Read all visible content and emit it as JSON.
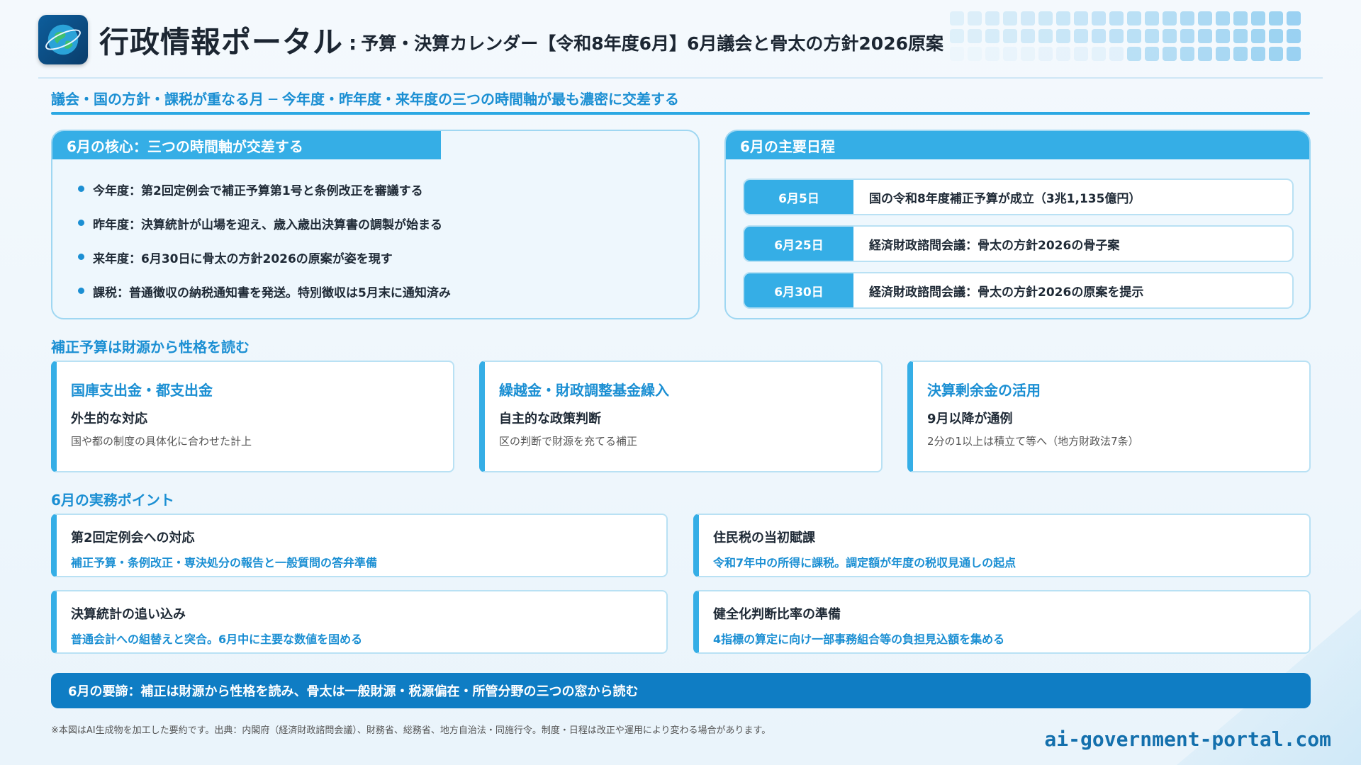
{
  "header": {
    "logo_icon": "globe-icon",
    "title": "行政情報ポータル",
    "separator": ":",
    "subtitle": "予算・決算カレンダー【令和8年度6月】6月議会と骨太の方針2026原案"
  },
  "tagline": "議会・国の方針・課税が重なる月 ─ 今年度・昨年度・来年度の三つの時間軸が最も濃密に交差する",
  "core": {
    "heading": "6月の核心：三つの時間軸が交差する",
    "items": [
      "今年度：第2回定例会で補正予算第1号と条例改正を審議する",
      "昨年度：決算統計が山場を迎え、歳入歳出決算書の調製が始まる",
      "来年度：6月30日に骨太の方針2026の原案が姿を現す",
      "課税：普通徴収の納税通知書を発送。特別徴収は5月末に通知済み"
    ]
  },
  "schedule": {
    "heading": "6月の主要日程",
    "rows": [
      {
        "date": "6月5日",
        "text": "国の令和8年度補正予算が成立（3兆1,135億円）"
      },
      {
        "date": "6月25日",
        "text": "経済財政諮問会議：骨太の方針2026の骨子案"
      },
      {
        "date": "6月30日",
        "text": "経済財政諮問会議：骨太の方針2026の原案を提示"
      }
    ]
  },
  "supplementary": {
    "heading": "補正予算は財源から性格を読む",
    "cards": [
      {
        "title": "国庫支出金・都支出金",
        "sub": "外生的な対応",
        "note": "国や都の制度の具体化に合わせた計上"
      },
      {
        "title": "繰越金・財政調整基金繰入",
        "sub": "自主的な政策判断",
        "note": "区の判断で財源を充てる補正"
      },
      {
        "title": "決算剰余金の活用",
        "sub": "9月以降が通例",
        "note": "2分の1以上は積立て等へ（地方財政法7条）"
      }
    ]
  },
  "practice": {
    "heading": "6月の実務ポイント",
    "cards": [
      {
        "title": "第2回定例会への対応",
        "note": "補正予算・条例改正・専決処分の報告と一般質問の答弁準備"
      },
      {
        "title": "住民税の当初賦課",
        "note": "令和7年中の所得に課税。調定額が年度の税収見通しの起点"
      },
      {
        "title": "決算統計の追い込み",
        "note": "普通会計への組替えと突合。6月中に主要な数値を固める"
      },
      {
        "title": "健全化判断比率の準備",
        "note": "4指標の算定に向け一部事務組合等の負担見込額を集める"
      }
    ]
  },
  "summary": "6月の要諦：補正は財源から性格を読み、骨太は一般財源・税源偏在・所管分野の三つの窓から読む",
  "footnote": "※本図はAI生成物を加工した要約です。出典：内閣府（経済財政諮問会議）、財務省、総務省、地方自治法・同施行令。制度・日程は改正や運用により変わる場合があります。",
  "site": "ai-government-portal.com",
  "colors": {
    "accent": "#35aee6",
    "accent_dark": "#0f7dc4",
    "text_blue": "#1b8fd3"
  }
}
